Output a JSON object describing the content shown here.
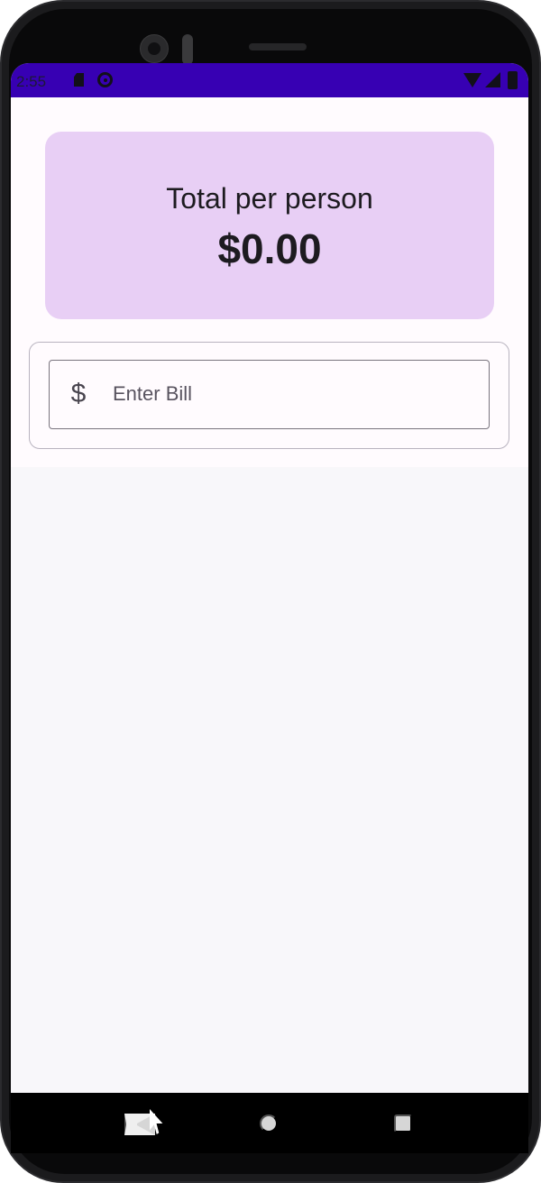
{
  "status_bar": {
    "time": "2:55",
    "icons": [
      "sim-card-icon",
      "sync-icon",
      "wifi-icon",
      "cellular-signal-icon",
      "battery-icon"
    ],
    "background_color": "#3700b3"
  },
  "tip_calculator": {
    "summary_card": {
      "label": "Total per person",
      "amount": "$0.00",
      "background_color": "#e8cff5"
    },
    "bill_input": {
      "leading_icon": "dollar-sign-icon",
      "leading_icon_text": "$",
      "placeholder": "Enter Bill",
      "value": ""
    }
  },
  "navigation_bar": {
    "buttons": [
      "back-icon",
      "home-icon",
      "recent-apps-icon"
    ]
  },
  "pointer": {
    "icon": "mouse-cursor-icon"
  }
}
